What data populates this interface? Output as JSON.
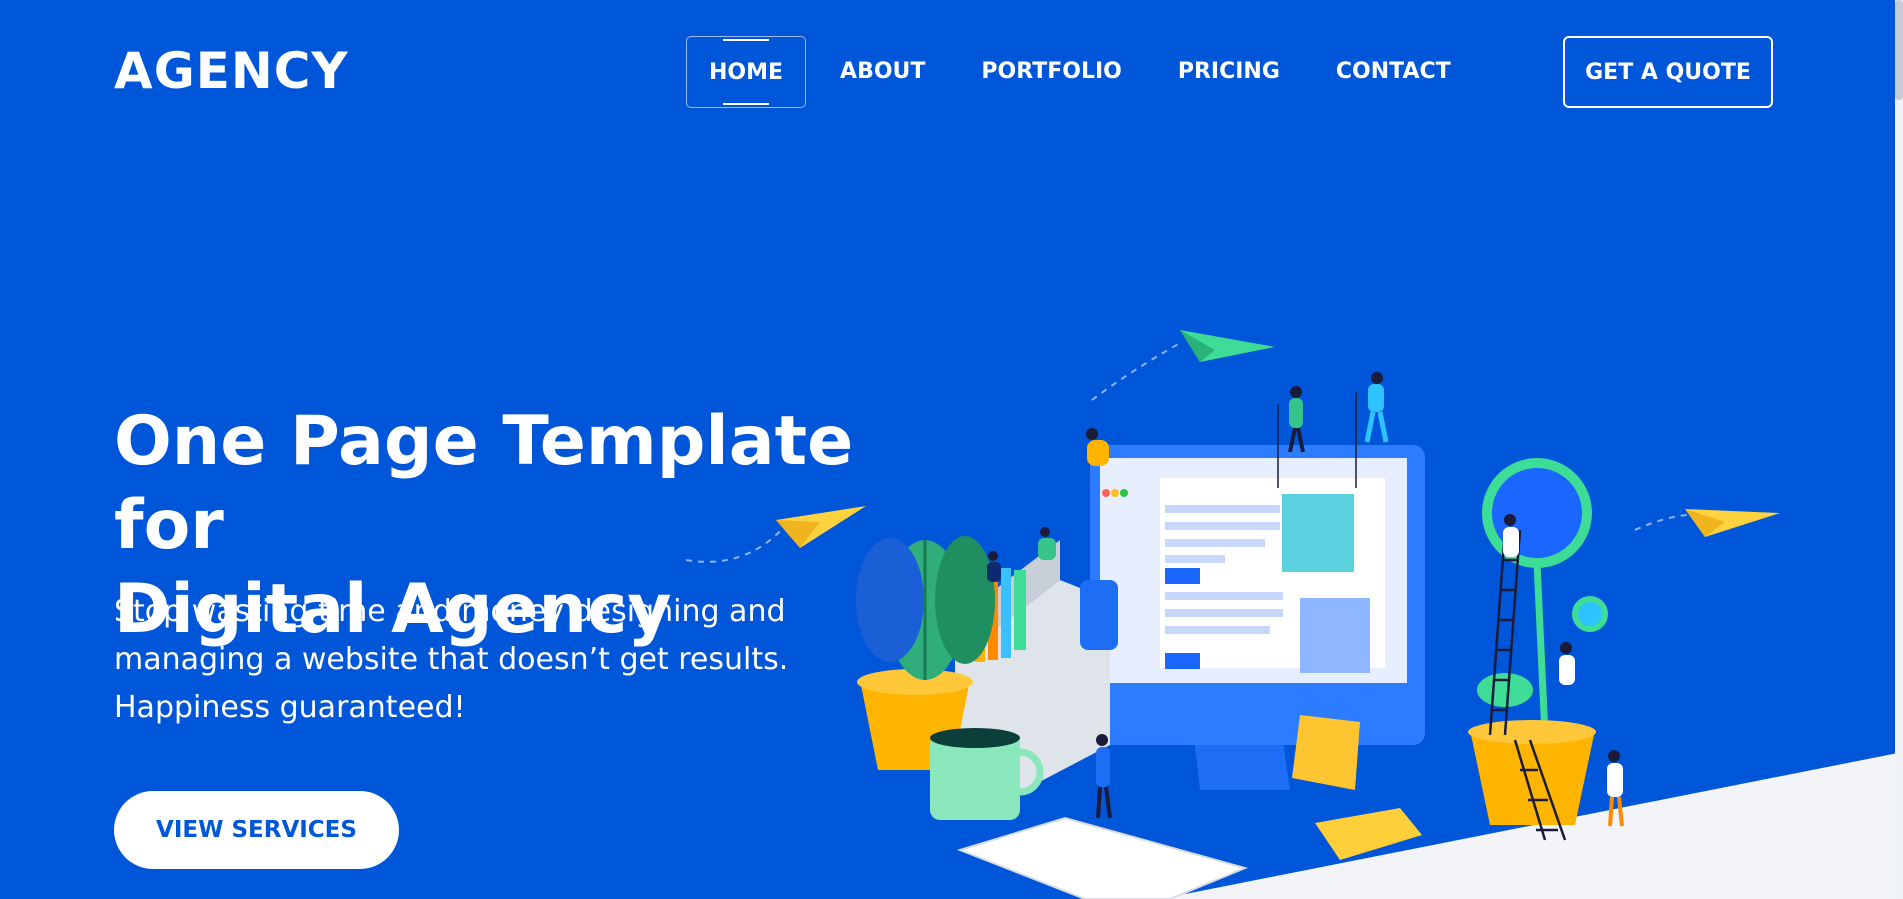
{
  "header": {
    "logo": "AGENCY",
    "nav": [
      "HOME",
      "ABOUT",
      "PORTFOLIO",
      "PRICING",
      "CONTACT"
    ],
    "active_nav": "HOME",
    "quote_button": "GET A QUOTE"
  },
  "hero": {
    "title_line1": "One Page Template for",
    "title_line2": "Digital Agency",
    "subtitle_line1": "Stop wasting time and money designing and",
    "subtitle_line2": "managing a website that doesn’t get results.",
    "subtitle_line3": "Happiness guaranteed!",
    "cta_button": "VIEW SERVICES"
  },
  "colors": {
    "brand_blue": "#0056d8",
    "white": "#ffffff",
    "light_gray": "#f2f4f8",
    "yellow": "#ffc530",
    "green": "#3ddc97"
  },
  "icons": [
    "paper-plane-icon",
    "plant-icon",
    "monitor-icon",
    "mug-icon",
    "keyboard-icon",
    "ladder-icon"
  ]
}
